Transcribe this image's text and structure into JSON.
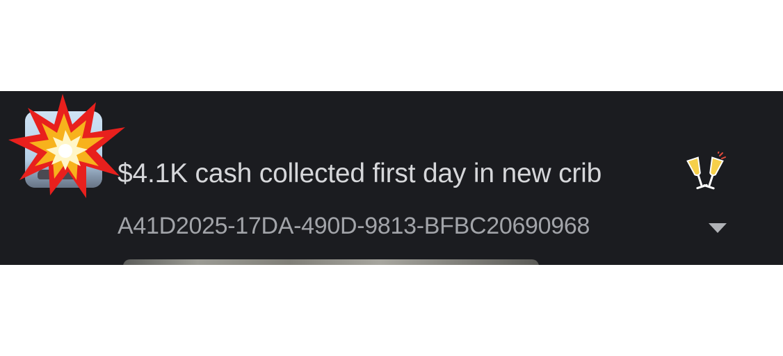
{
  "message": {
    "title": "$4.1K cash collected first day in new crib",
    "message_id": "A41D2025-17DA-490D-9813-BFBC20690968"
  },
  "avatar": {
    "icon": "collision-emoji-icon"
  },
  "title_icon": "clinking-glasses-icon",
  "colors": {
    "bar_background": "#1b1c20",
    "title_text": "#d6d7da",
    "id_text": "#a2a4a9"
  }
}
